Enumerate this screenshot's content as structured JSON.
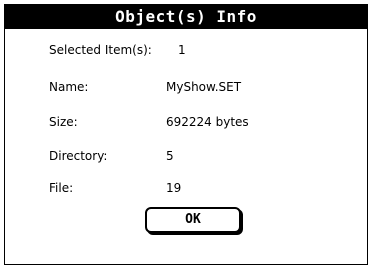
{
  "dialog": {
    "title": "Object(s) Info",
    "fields": [
      {
        "label": "Selected Item(s):",
        "value": "1"
      },
      {
        "label": "Name:",
        "value": "MyShow.SET"
      },
      {
        "label": "Size:",
        "value": "692224 bytes"
      },
      {
        "label": "Directory:",
        "value": "5"
      },
      {
        "label": "File:",
        "value": "19"
      }
    ],
    "ok_label": "OK"
  }
}
